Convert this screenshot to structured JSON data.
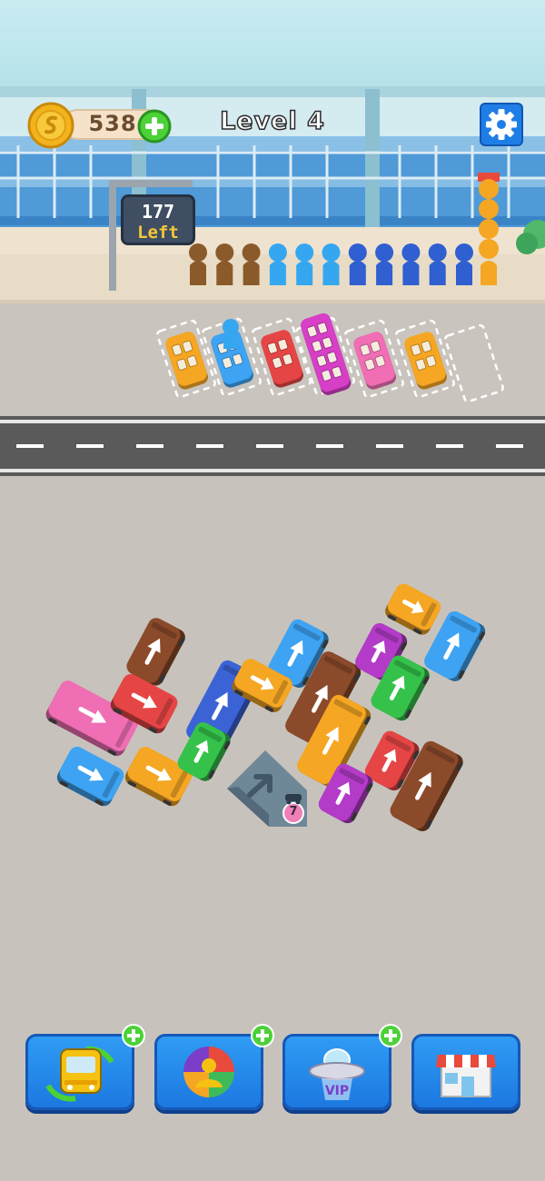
{
  "hud": {
    "coins": "538",
    "level_title": "Level 4",
    "people_left_count": "177",
    "people_left_label": "Left"
  },
  "icons": [
    "coin-icon",
    "add-coins-icon",
    "gear-icon",
    "bus-swap-icon",
    "player-avatar-icon",
    "ufo-vip-icon",
    "shop-icon",
    "plus-icon",
    "car-icon"
  ],
  "vip_label": "VIP",
  "tunnel": {
    "count": "7"
  },
  "queue_colors": [
    "#8b5a2b",
    "#8b5a2b",
    "#8b5a2b",
    "#35a7f0",
    "#35a7f0",
    "#35a7f0",
    "#2f5fd0",
    "#2f5fd0",
    "#2f5fd0",
    "#2f5fd0",
    "#2f5fd0"
  ],
  "waiting_column_colors": [
    "#f5a623",
    "#f5a623",
    "#f5a623",
    "#f5a623"
  ],
  "parking_slots": [
    "orange",
    "blue",
    "red",
    "magenta",
    "pink",
    "orange",
    "empty"
  ],
  "toolbar": {
    "buttons": [
      {
        "name": "bus-swap-button",
        "has_plus": true
      },
      {
        "name": "shuffle-colors-button",
        "has_plus": true
      },
      {
        "name": "vip-ufo-button",
        "has_plus": true
      },
      {
        "name": "shop-button",
        "has_plus": false
      }
    ]
  },
  "colors": {
    "orange": "#f5a623",
    "blue": "#3da3f2",
    "red": "#e64545",
    "magenta": "#d63fc6",
    "pink": "#f06eb4",
    "green": "#35c24a",
    "brown": "#8b4a2a",
    "purple": "#b33bc8",
    "royal": "#3b63d6",
    "accent": "#1c78e0",
    "coin": "#f3b31c"
  }
}
